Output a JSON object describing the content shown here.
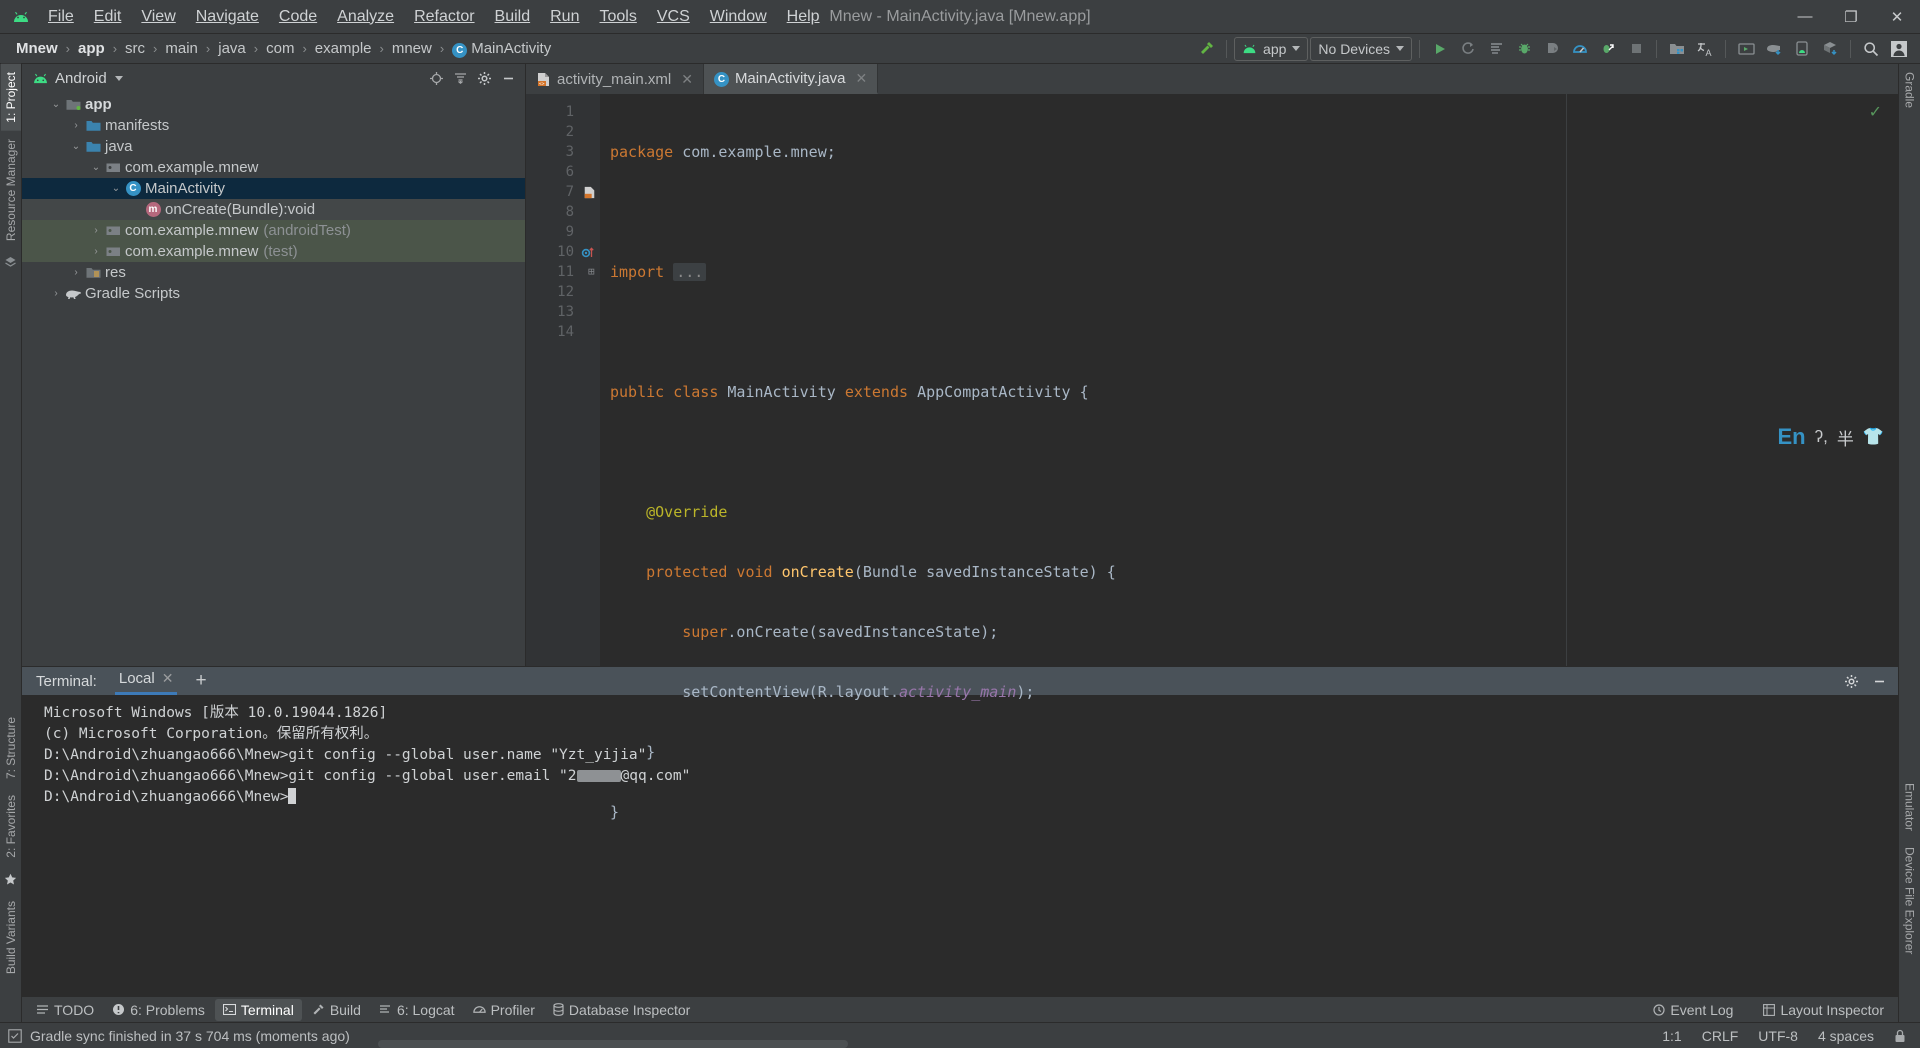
{
  "window": {
    "title": "Mnew - MainActivity.java [Mnew.app]",
    "minimize": "—",
    "maximize": "❐",
    "close": "✕"
  },
  "menu": [
    {
      "label": "File"
    },
    {
      "label": "Edit"
    },
    {
      "label": "View"
    },
    {
      "label": "Navigate"
    },
    {
      "label": "Code"
    },
    {
      "label": "Analyze"
    },
    {
      "label": "Refactor"
    },
    {
      "label": "Build"
    },
    {
      "label": "Run"
    },
    {
      "label": "Tools"
    },
    {
      "label": "VCS"
    },
    {
      "label": "Window"
    },
    {
      "label": "Help"
    }
  ],
  "breadcrumbs": [
    {
      "label": "Mnew",
      "bold": true
    },
    {
      "label": "app",
      "bold": true
    },
    {
      "label": "src"
    },
    {
      "label": "main"
    },
    {
      "label": "java"
    },
    {
      "label": "com"
    },
    {
      "label": "example"
    },
    {
      "label": "mnew"
    },
    {
      "label": "MainActivity",
      "icon": "class-icon"
    }
  ],
  "toolbar": {
    "build_icon": "hammer-icon",
    "run_config": "app",
    "device_select": "No Devices",
    "icons": [
      "run-icon",
      "rerun-icon",
      "apply-changes-icon",
      "debug-icon",
      "attach-debugger-icon",
      "profiler-icon",
      "debug-attach-process-icon",
      "stop-icon",
      "project-structure-icon",
      "translate-icon",
      "avd-manager-icon",
      "sync-gradle-icon",
      "device-manager-icon",
      "sdk-manager-icon",
      "search-icon",
      "avatar-icon"
    ]
  },
  "project": {
    "view_title": "Android",
    "view_icon": "android-icon",
    "actions": [
      "locate-icon",
      "collapse-all-icon",
      "settings-icon",
      "hide-icon"
    ],
    "tree": [
      {
        "label": "app",
        "indent": 0,
        "twist": "⌄",
        "icon": "module-folder-icon",
        "bold": true,
        "state": "normal"
      },
      {
        "label": "manifests",
        "indent": 1,
        "twist": "›",
        "icon": "folder-icon",
        "state": "normal"
      },
      {
        "label": "java",
        "indent": 1,
        "twist": "⌄",
        "icon": "folder-icon",
        "state": "normal"
      },
      {
        "label": "com.example.mnew",
        "indent": 2,
        "twist": "⌄",
        "icon": "package-icon",
        "state": "normal"
      },
      {
        "label": "MainActivity",
        "indent": 3,
        "twist": "⌄",
        "icon": "class-icon",
        "state": "selected"
      },
      {
        "label": "onCreate(Bundle):void",
        "indent": 4,
        "twist": "",
        "icon": "method-icon",
        "state": "soft"
      },
      {
        "label": "com.example.mnew",
        "suffix": "(androidTest)",
        "indent": 2,
        "twist": "›",
        "icon": "package-icon",
        "state": "test"
      },
      {
        "label": "com.example.mnew",
        "suffix": "(test)",
        "indent": 2,
        "twist": "›",
        "icon": "package-icon",
        "state": "test"
      },
      {
        "label": "res",
        "indent": 1,
        "twist": "›",
        "icon": "res-folder-icon",
        "state": "normal"
      },
      {
        "label": "Gradle Scripts",
        "indent": 0,
        "twist": "›",
        "icon": "gradle-icon",
        "state": "normal"
      }
    ]
  },
  "left_rail": [
    {
      "label": "1: Project",
      "icon": "project-icon",
      "selected": true
    },
    {
      "label": "Resource Manager",
      "icon": "resource-icon",
      "selected": false
    },
    {
      "label": "7: Structure",
      "icon": "structure-icon",
      "selected": false
    },
    {
      "label": "2: Favorites",
      "icon": "favorites-icon",
      "selected": false
    },
    {
      "label": "Build Variants",
      "icon": "build-variants-icon",
      "selected": false
    }
  ],
  "right_rail": [
    {
      "label": "Gradle",
      "icon": "gradle-icon"
    },
    {
      "label": "Emulator",
      "icon": "emulator-icon"
    },
    {
      "label": "Device File Explorer",
      "icon": "device-file-icon"
    }
  ],
  "editor": {
    "tabs": [
      {
        "label": "activity_main.xml",
        "icon": "xml-layout-icon",
        "active": false,
        "close": "✕"
      },
      {
        "label": "MainActivity.java",
        "icon": "class-icon",
        "active": true,
        "close": "✕"
      }
    ],
    "gutter_lines": [
      "1",
      "2",
      "3",
      "6",
      "7",
      "8",
      "9",
      "10",
      "11",
      "12",
      "13",
      "14"
    ],
    "code_lines": [
      "package com.example.mnew;",
      "",
      "import ...",
      "",
      "public class MainActivity extends AppCompatActivity {",
      "",
      "    @Override",
      "    protected void onCreate(Bundle savedInstanceState) {",
      "        super.onCreate(savedInstanceState);",
      "        setContentView(R.layout.activity_main);",
      "    }",
      "}"
    ],
    "inspection_status": "✓",
    "ime": {
      "lang": "En",
      "punct": "ʔ,",
      "half": "半",
      "extra": "👕"
    }
  },
  "terminal": {
    "label": "Terminal:",
    "tab": "Local",
    "tab_close": "✕",
    "add": "+",
    "settings_icon": "gear-icon",
    "hide_icon": "hide-icon",
    "lines": [
      "Microsoft Windows [版本 10.0.19044.1826]",
      "(c) Microsoft Corporation。保留所有权利。",
      "",
      "D:\\Android\\zhuangao666\\Mnew>git config --global user.name \"Yzt_yijia\"",
      "",
      "D:\\Android\\zhuangao666\\Mnew>git config --global user.email \"",
      "",
      "D:\\Android\\zhuangao666\\Mnew>"
    ],
    "email_suffix": "@qq.com\"",
    "email_prefix": "\"",
    "email_visible_start": "2"
  },
  "bottom_tabs": [
    {
      "label": "TODO",
      "icon": "todo-icon",
      "selected": false
    },
    {
      "label": "6: Problems",
      "icon": "problems-icon",
      "selected": false
    },
    {
      "label": "Terminal",
      "icon": "terminal-icon",
      "selected": true
    },
    {
      "label": "Build",
      "icon": "build-icon",
      "selected": false
    },
    {
      "label": "6: Logcat",
      "icon": "logcat-icon",
      "selected": false
    },
    {
      "label": "Profiler",
      "icon": "profiler-icon",
      "selected": false
    },
    {
      "label": "Database Inspector",
      "icon": "database-icon",
      "selected": false
    }
  ],
  "bottom_right_tabs": [
    {
      "label": "Event Log",
      "icon": "event-log-icon"
    },
    {
      "label": "Layout Inspector",
      "icon": "layout-inspector-icon"
    }
  ],
  "status_bar": {
    "icon": "gradle-status-icon",
    "message": "Gradle sync finished in 37 s 704 ms (moments ago)",
    "caret": "1:1",
    "line_sep": "CRLF",
    "encoding": "UTF-8",
    "indent": "4 spaces",
    "lock_icon": "lock-icon"
  },
  "colors": {
    "accent": "#3592c4",
    "green": "#3ddc84",
    "selection": "#0d293e",
    "test_bg": "#4b5549",
    "keyword": "#cc7832",
    "string": "#6a8759",
    "annotation": "#bbb529",
    "method": "#ffc66d",
    "field": "#9876aa"
  }
}
